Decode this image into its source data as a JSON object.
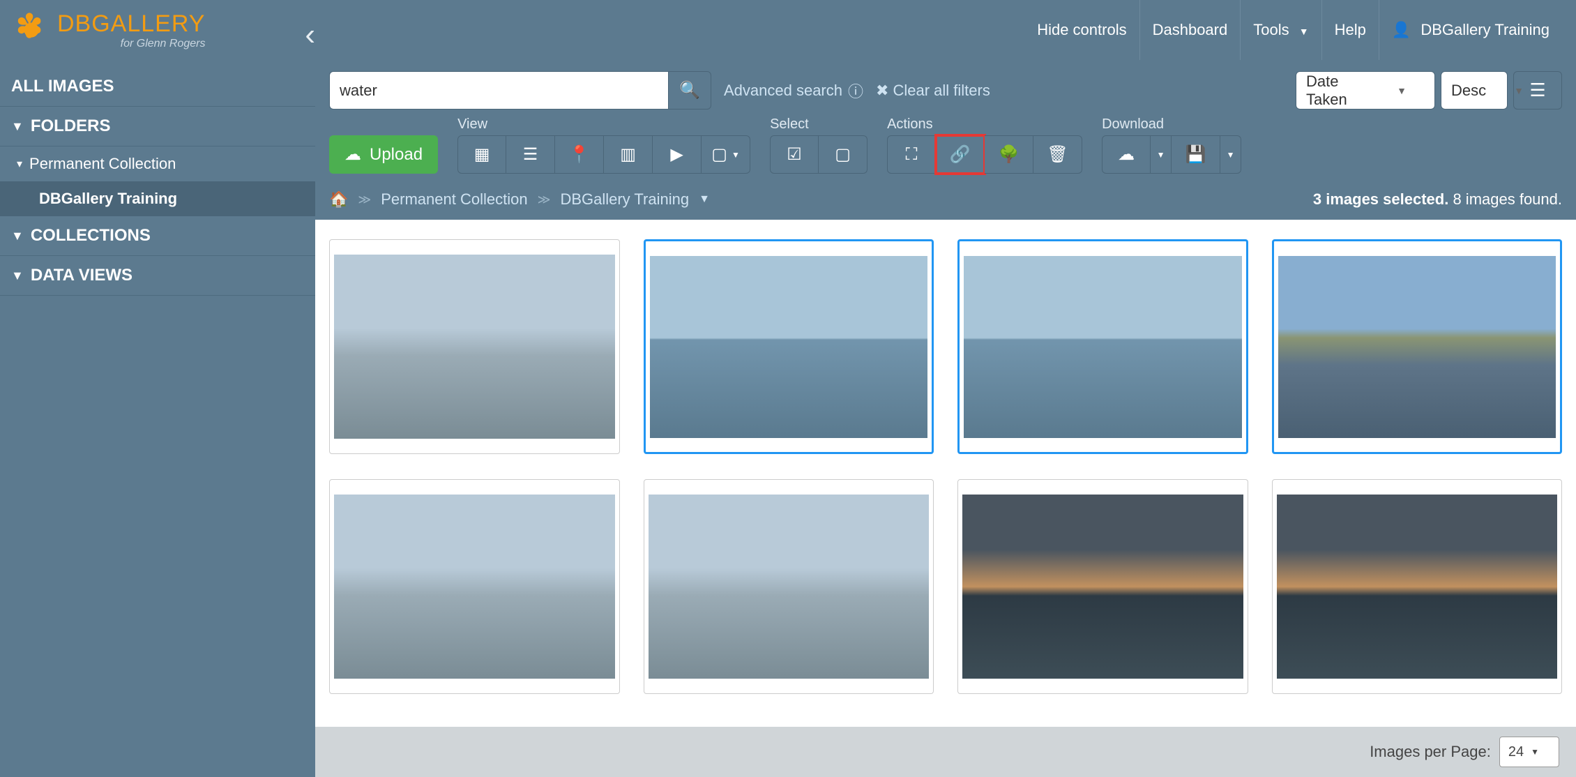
{
  "brand": {
    "name": "DBGALLERY",
    "subtitle": "for Glenn Rogers"
  },
  "top_nav": {
    "hide_controls": "Hide controls",
    "dashboard": "Dashboard",
    "tools": "Tools",
    "help": "Help",
    "user": "DBGallery Training"
  },
  "sidebar": {
    "all_images": "ALL IMAGES",
    "folders": "FOLDERS",
    "permanent_collection": "Permanent Collection",
    "dbgallery_training": "DBGallery Training",
    "collections": "COLLECTIONS",
    "data_views": "DATA VIEWS"
  },
  "search": {
    "value": "water",
    "advanced": "Advanced search",
    "clear": "Clear all filters"
  },
  "sort": {
    "field": "Date Taken",
    "direction": "Desc"
  },
  "toolbar": {
    "upload": "Upload",
    "view_label": "View",
    "select_label": "Select",
    "actions_label": "Actions",
    "download_label": "Download"
  },
  "breadcrumb": {
    "permanent_collection": "Permanent Collection",
    "dbgallery_training": "DBGallery Training"
  },
  "status": {
    "selected": "3 images selected.",
    "found": "8 images found."
  },
  "pagination": {
    "label": "Images per Page:",
    "value": "24"
  }
}
